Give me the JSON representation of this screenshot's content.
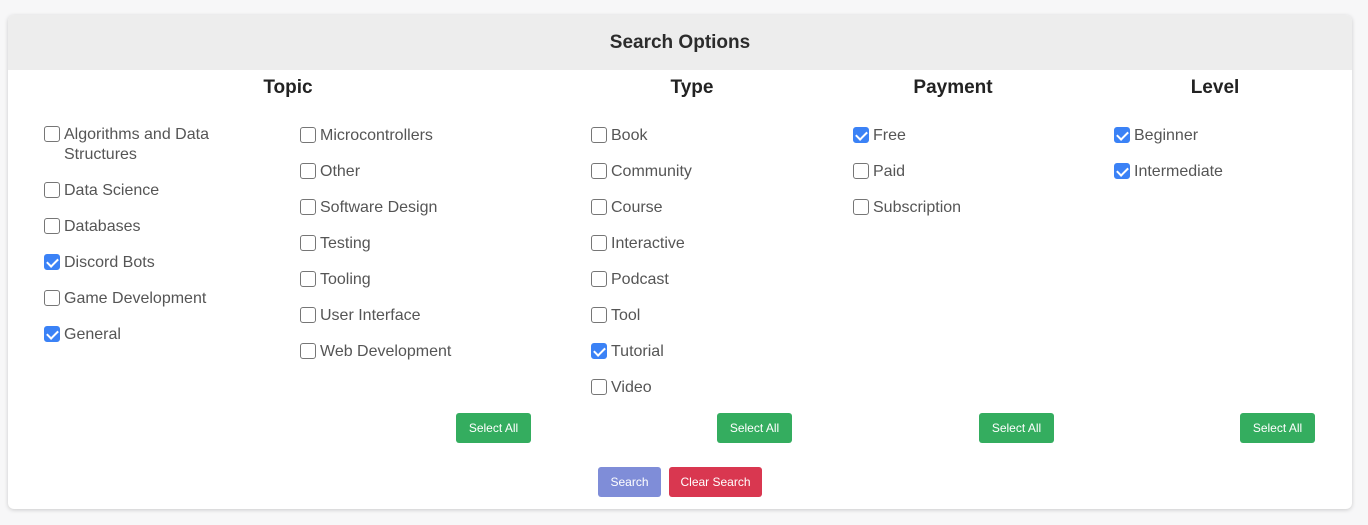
{
  "header": {
    "title": "Search Options"
  },
  "topic": {
    "title": "Topic",
    "items": [
      {
        "label": "Algorithms and Data Structures",
        "checked": false
      },
      {
        "label": "Data Science",
        "checked": false
      },
      {
        "label": "Databases",
        "checked": false
      },
      {
        "label": "Discord Bots",
        "checked": true
      },
      {
        "label": "Game Development",
        "checked": false
      },
      {
        "label": "General",
        "checked": true
      },
      {
        "label": "Microcontrollers",
        "checked": false
      },
      {
        "label": "Other",
        "checked": false
      },
      {
        "label": "Software Design",
        "checked": false
      },
      {
        "label": "Testing",
        "checked": false
      },
      {
        "label": "Tooling",
        "checked": false
      },
      {
        "label": "User Interface",
        "checked": false
      },
      {
        "label": "Web Development",
        "checked": false
      }
    ],
    "select_all": "Select All"
  },
  "type": {
    "title": "Type",
    "items": [
      {
        "label": "Book",
        "checked": false
      },
      {
        "label": "Community",
        "checked": false
      },
      {
        "label": "Course",
        "checked": false
      },
      {
        "label": "Interactive",
        "checked": false
      },
      {
        "label": "Podcast",
        "checked": false
      },
      {
        "label": "Tool",
        "checked": false
      },
      {
        "label": "Tutorial",
        "checked": true
      },
      {
        "label": "Video",
        "checked": false
      }
    ],
    "select_all": "Select All"
  },
  "payment": {
    "title": "Payment",
    "items": [
      {
        "label": "Free",
        "checked": true
      },
      {
        "label": "Paid",
        "checked": false
      },
      {
        "label": "Subscription",
        "checked": false
      }
    ],
    "select_all": "Select All"
  },
  "level": {
    "title": "Level",
    "items": [
      {
        "label": "Beginner",
        "checked": true
      },
      {
        "label": "Intermediate",
        "checked": true
      }
    ],
    "select_all": "Select All"
  },
  "actions": {
    "search": "Search",
    "clear": "Clear Search"
  },
  "colors": {
    "checkbox_accent": "#3b82f6",
    "select_all_bg": "#34ad5f",
    "search_bg": "#7f8dd8",
    "clear_bg": "#d93750"
  }
}
